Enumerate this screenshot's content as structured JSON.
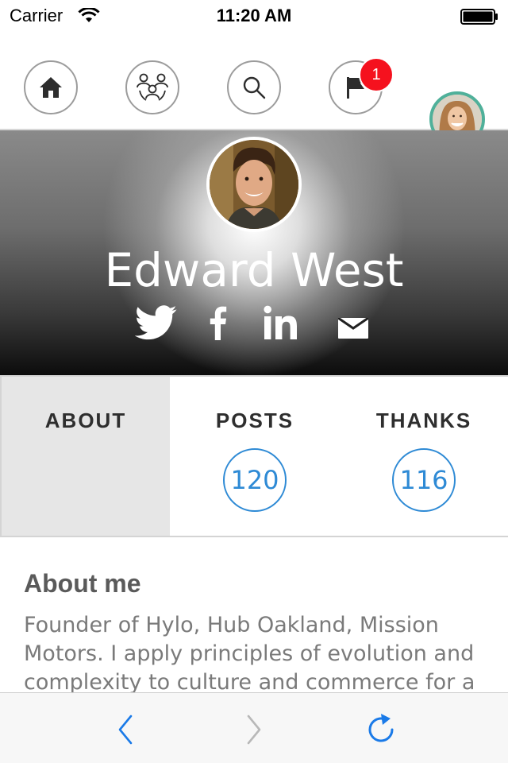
{
  "status_bar": {
    "carrier": "Carrier",
    "time": "11:20 AM"
  },
  "nav": {
    "items": [
      {
        "icon": "home-icon"
      },
      {
        "icon": "groups-icon"
      },
      {
        "icon": "search-icon"
      },
      {
        "icon": "flag-icon"
      }
    ],
    "notification_count": "1",
    "accent_color": "#4fb09a"
  },
  "profile": {
    "name": "Edward West",
    "social": [
      "twitter-icon",
      "facebook-icon",
      "linkedin-icon",
      "email-icon"
    ]
  },
  "tabs": {
    "about": {
      "label": "ABOUT"
    },
    "posts": {
      "label": "POSTS",
      "count": "120"
    },
    "thanks": {
      "label": "THANKS",
      "count": "116"
    },
    "active": "about",
    "count_color": "#2e8ad5"
  },
  "about": {
    "title": "About me",
    "text": "Founder of Hylo, Hub Oakland, Mission Motors. I apply principles of evolution and complexity to culture and commerce for a"
  },
  "toolbar": {
    "icons": [
      "back-icon",
      "forward-icon",
      "reload-icon"
    ],
    "tint": "#1a7ae8"
  }
}
